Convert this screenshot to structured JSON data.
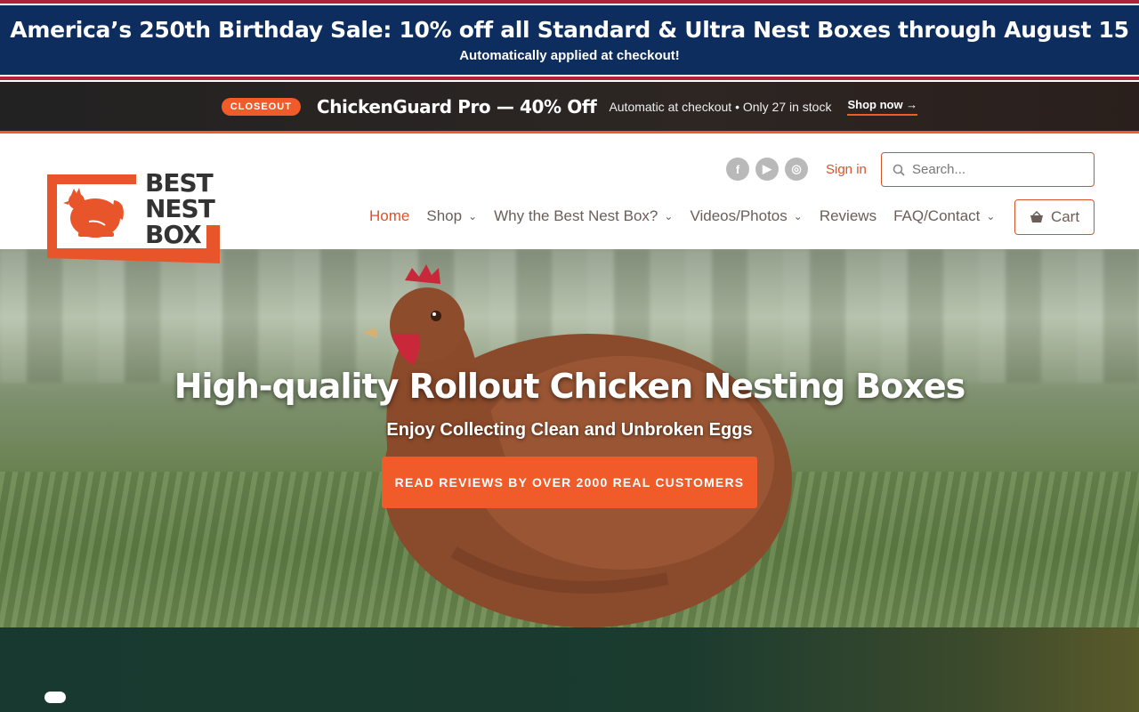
{
  "announcement": {
    "headline": "America’s 250th Birthday Sale: 10% off all Standard & Ultra Nest Boxes through August 15",
    "subline": "Automatically applied at checkout!"
  },
  "closeout": {
    "badge": "CLOSEOUT",
    "title": "ChickenGuard Pro — 40% Off",
    "details": "Automatic at checkout • Only 27 in stock",
    "cta": "Shop now →"
  },
  "header": {
    "logo_lines": [
      "BEST",
      "NEST",
      "BOX"
    ],
    "social": [
      {
        "icon": "facebook-icon",
        "glyph": "f"
      },
      {
        "icon": "youtube-icon",
        "glyph": "▶"
      },
      {
        "icon": "instagram-icon",
        "glyph": "◎"
      }
    ],
    "signin": "Sign in",
    "search_placeholder": "Search...",
    "nav": [
      {
        "label": "Home",
        "active": true,
        "dropdown": false
      },
      {
        "label": "Shop",
        "dropdown": true
      },
      {
        "label": "Why the Best Nest Box?",
        "dropdown": true
      },
      {
        "label": "Videos/Photos",
        "dropdown": true
      },
      {
        "label": "Reviews",
        "dropdown": false
      },
      {
        "label": "FAQ/Contact",
        "dropdown": true
      }
    ],
    "cart": "Cart"
  },
  "hero": {
    "title": "High-quality Rollout Chicken Nesting Boxes",
    "subtitle": "Enjoy Collecting Clean and Unbroken Eggs",
    "cta": "READ REVIEWS BY OVER 2000 REAL CUSTOMERS"
  },
  "colors": {
    "accent": "#f15a29",
    "navy": "#0d2d5e",
    "red": "#b3203a"
  }
}
